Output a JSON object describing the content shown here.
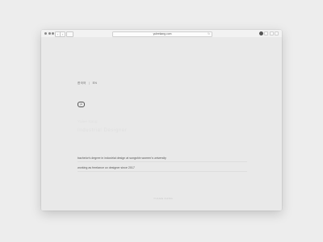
{
  "browser": {
    "url": "yuleekang.com",
    "back_icon": "chevron-left-icon",
    "forward_icon": "chevron-right-icon",
    "reload_icon": "reload-icon"
  },
  "nav": {
    "lang_ko": "한국어",
    "separator": "|",
    "lang_en": "EN"
  },
  "logo": {
    "text": "yk"
  },
  "faded": {
    "line1": "Yulee Kang",
    "line2": "Industrial Designer"
  },
  "bio": {
    "line1": "bachelor's degree in industrial design at sungshin women's university",
    "line2": "working as freelance ux designer since 2017"
  },
  "footer": {
    "text": "YULEE KANG"
  }
}
